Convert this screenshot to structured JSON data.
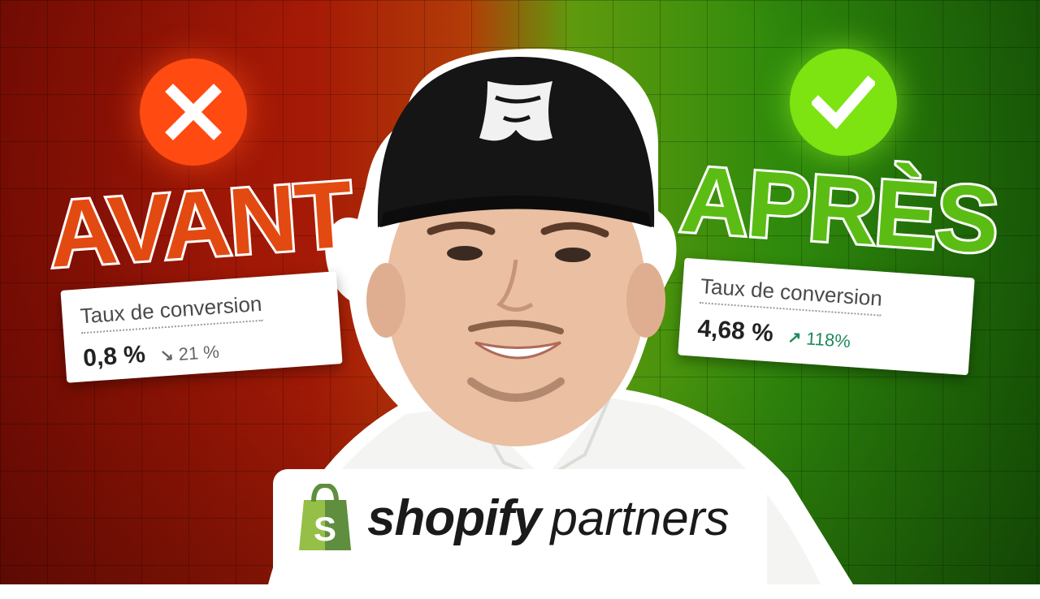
{
  "left": {
    "word": "AVANT",
    "card": {
      "label": "Taux de conversion",
      "value": "0,8 %",
      "delta": "21 %"
    }
  },
  "right": {
    "word": "APRÈS",
    "card": {
      "label": "Taux de conversion",
      "value": "4,68 %",
      "delta": "118%"
    }
  },
  "brand": {
    "name": "shopify",
    "suffix": "partners"
  },
  "colors": {
    "negative": "#ff4a12",
    "positive": "#7de311",
    "delta_up": "#1e8a5a"
  },
  "icons": {
    "left_badge": "x-icon",
    "right_badge": "check-icon",
    "logo": "shopify-bag-icon"
  }
}
